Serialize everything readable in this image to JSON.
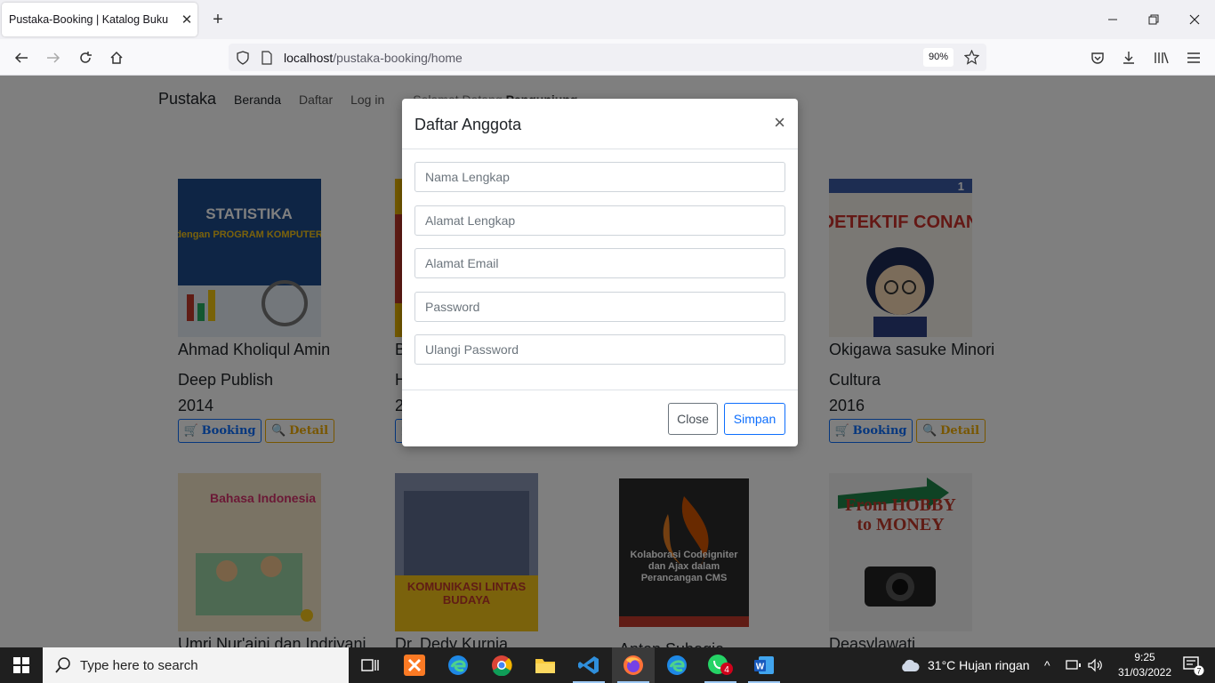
{
  "browser": {
    "tab_title": "Pustaka-Booking | Katalog Buku",
    "url_host": "localhost",
    "url_path": "/pustaka-booking/home",
    "zoom": "90%"
  },
  "site": {
    "brand": "Pustaka",
    "nav": [
      "Beranda",
      "Daftar",
      "Log in"
    ],
    "welcome_prefix": "Selamat Datang",
    "welcome_name": "Pengunjung"
  },
  "books": [
    {
      "author": "Ahmad Kholiqul Amin",
      "publisher": "Deep Publish",
      "year": "2014",
      "cover_title": "STATISTIKA",
      "cover_sub": "dengan PROGRAM KOMPUTER",
      "cover_color": "#1d4a8a"
    },
    {
      "author": "B",
      "publisher": "H",
      "year": "2",
      "cover_title": "",
      "cover_sub": "",
      "cover_color": "#e8b400"
    },
    {
      "author": "Okigawa sasuke Minori",
      "publisher": "Cultura",
      "year": "2016",
      "cover_title": "DETEKTIF CONAN",
      "cover_sub": "1",
      "cover_color": "#c8302a"
    },
    {
      "author": "Umri Nur'aini dan Indriyani",
      "cover_title": "Bahasa Indonesia",
      "cover_color": "#f4e7c9"
    },
    {
      "author": "Dr. Dedy Kurnia",
      "cover_title": "KOMUNIKASI LINTAS BUDAYA",
      "cover_color": "#6c7fa0"
    },
    {
      "author": "Anton Subagia",
      "cover_title": "Kolaborasi Codeigniter dan Ajax dalam Perancangan CMS",
      "cover_color": "#2a2a2a"
    },
    {
      "author": "Deasylawati",
      "cover_title": "From HOBBY to MONEY",
      "cover_color": "#f3f3f3"
    }
  ],
  "buttons": {
    "booking": "Booking",
    "detail": "Detail"
  },
  "modal": {
    "title": "Daftar Anggota",
    "close_x": "×",
    "placeholders": {
      "nama": "Nama Lengkap",
      "alamat": "Alamat Lengkap",
      "email": "Alamat Email",
      "password": "Password",
      "password2": "Ulangi Password"
    },
    "close_label": "Close",
    "save_label": "Simpan"
  },
  "taskbar": {
    "search_placeholder": "Type here to search",
    "weather": "31°C  Hujan ringan",
    "time": "9:25",
    "date": "31/03/2022",
    "whatsapp_badge": "4",
    "notification_count": "7"
  }
}
